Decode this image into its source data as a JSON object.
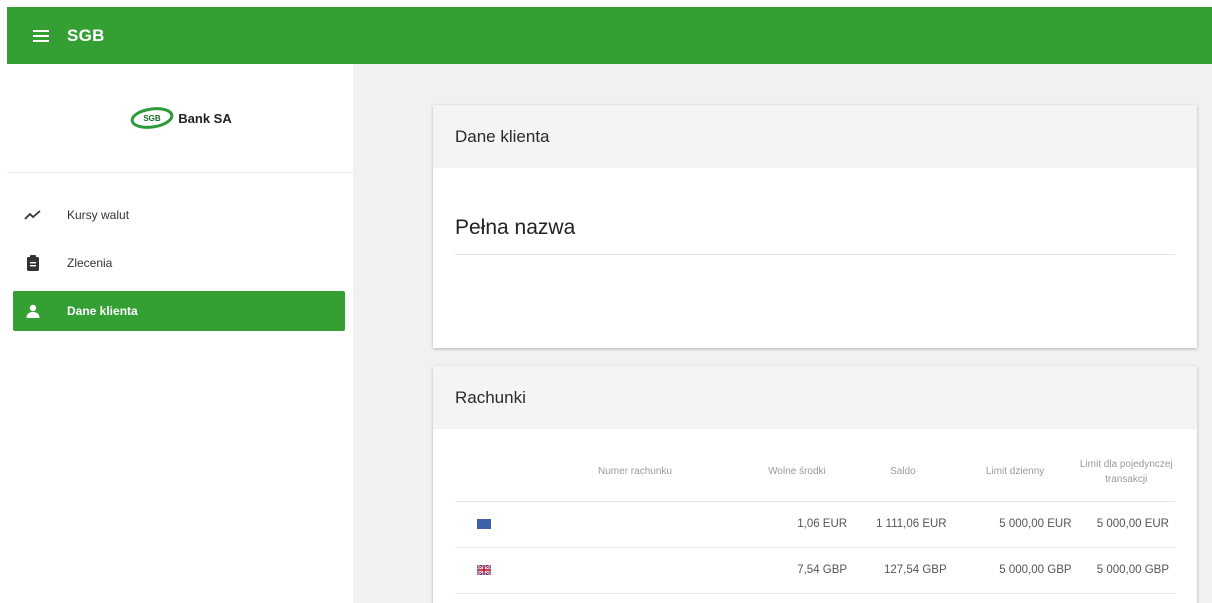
{
  "app": {
    "title": "SGB"
  },
  "logo": {
    "mark": "SGB",
    "text": "Bank SA"
  },
  "sidebar": {
    "items": [
      {
        "label": "Kursy walut",
        "icon": "trending-icon"
      },
      {
        "label": "Zlecenia",
        "icon": "clipboard-icon"
      },
      {
        "label": "Dane klienta",
        "icon": "person-icon",
        "active": true
      }
    ]
  },
  "client_card": {
    "title": "Dane klienta",
    "field_label": "Pełna nazwa"
  },
  "accounts_card": {
    "title": "Rachunki",
    "columns": [
      "",
      "Numer rachunku",
      "Wolne środki",
      "Saldo",
      "Limit dzienny",
      "Limit dla pojedynczej transakcji"
    ],
    "rows": [
      {
        "flag": "eu-flag-icon",
        "account": "",
        "available": "1,06 EUR",
        "balance": "1 111,06 EUR",
        "daily_limit": "5 000,00 EUR",
        "single_limit": "5 000,00 EUR"
      },
      {
        "flag": "gb-flag-icon",
        "account": "",
        "available": "7,54 GBP",
        "balance": "127,54 GBP",
        "daily_limit": "5 000,00 GBP",
        "single_limit": "5 000,00 GBP"
      }
    ]
  },
  "colors": {
    "primary": "#34a034",
    "background": "#f1f1f1",
    "card_header": "#f4f4f4"
  }
}
